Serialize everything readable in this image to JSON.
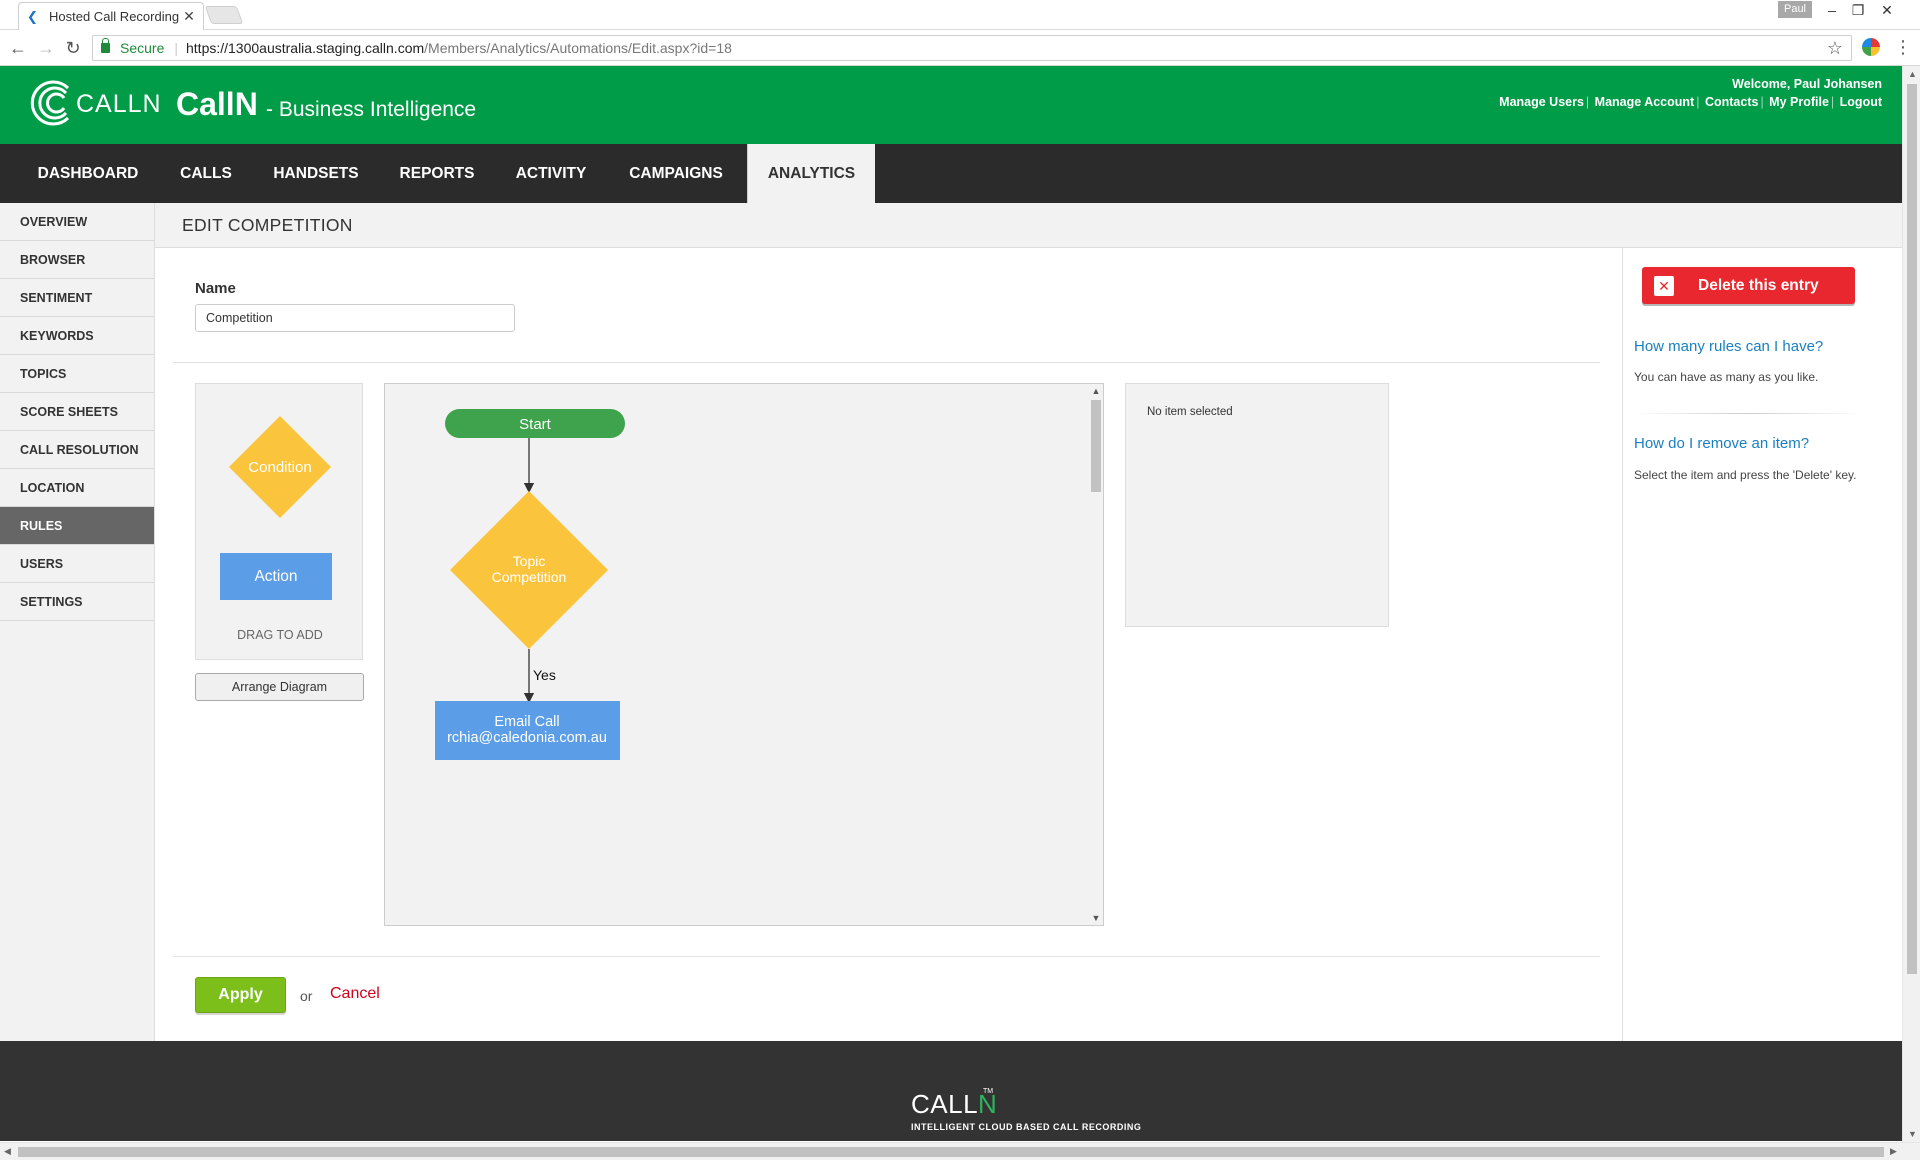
{
  "browser": {
    "tab_title": "Hosted Call Recording | C",
    "tab_close": "✕",
    "window_user": "Paul",
    "secure_label": "Secure",
    "url_host": "https://1300australia.staging.calln.com",
    "url_path": "/Members/Analytics/Automations/Edit.aspx?id=18"
  },
  "header": {
    "logo_text": "CALLN",
    "brand": "CallN",
    "brand_sub": "- Business Intelligence",
    "welcome": "Welcome, Paul Johansen",
    "links": [
      "Manage Users",
      "Manage Account",
      "Contacts",
      "My Profile",
      "Logout"
    ]
  },
  "mainnav": {
    "items": [
      "DASHBOARD",
      "CALLS",
      "HANDSETS",
      "REPORTS",
      "ACTIVITY",
      "CAMPAIGNS",
      "ANALYTICS"
    ],
    "active": "ANALYTICS"
  },
  "sidebar": {
    "items": [
      "OVERVIEW",
      "BROWSER",
      "SENTIMENT",
      "KEYWORDS",
      "TOPICS",
      "SCORE SHEETS",
      "CALL RESOLUTION",
      "LOCATION",
      "RULES",
      "USERS",
      "SETTINGS"
    ],
    "active": "RULES"
  },
  "page": {
    "title": "EDIT COMPETITION",
    "name_label": "Name",
    "name_value": "Competition"
  },
  "palette": {
    "condition_label": "Condition",
    "action_label": "Action",
    "drag_hint": "DRAG TO ADD",
    "arrange_button": "Arrange Diagram"
  },
  "diagram": {
    "start_label": "Start",
    "condition_line1": "Topic",
    "condition_line2": "Competition",
    "yes_label": "Yes",
    "action_line1": "Email Call",
    "action_line2": "rchia@caledonia.com.au"
  },
  "properties": {
    "empty_text": "No item selected"
  },
  "form_actions": {
    "apply": "Apply",
    "or": "or",
    "cancel": "Cancel"
  },
  "help": {
    "delete_button": "Delete this entry",
    "q1": "How many rules can I have?",
    "a1": "You can have as many as you like.",
    "q2": "How do I remove an item?",
    "a2": "Select the item and press the 'Delete' key."
  },
  "footer": {
    "logo_a": "CALL",
    "logo_n": "N",
    "tm": "TM",
    "tagline": "INTELLIGENT CLOUD BASED CALL RECORDING"
  },
  "colors": {
    "header_green": "#009c47",
    "nav_dark": "#2b2b2b",
    "condition_yellow": "#fbc43d",
    "action_blue": "#5b9de6",
    "start_green": "#3fa34d",
    "apply_green": "#7cbf1b",
    "delete_red": "#e8282e",
    "link_blue": "#1a7fc1"
  }
}
